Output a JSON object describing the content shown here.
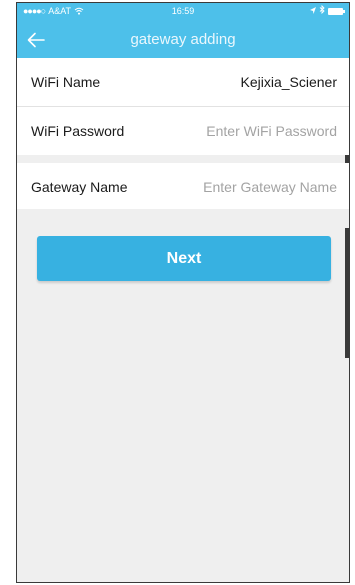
{
  "status_bar": {
    "carrier": "A&AT",
    "time": "16:59"
  },
  "header": {
    "title": "gateway adding",
    "back_icon": "back-arrow-icon"
  },
  "form": {
    "wifi_name_label": "WiFi Name",
    "wifi_name_value": "Kejixia_Sciener",
    "wifi_password_label": "WiFi Password",
    "wifi_password_placeholder": "Enter WiFi Password",
    "gateway_name_label": "Gateway Name",
    "gateway_name_placeholder": "Enter Gateway Name"
  },
  "actions": {
    "next_label": "Next"
  },
  "colors": {
    "header_bg": "#4dc0ea",
    "button_bg": "#37b1e1",
    "page_bg": "#efefef"
  }
}
